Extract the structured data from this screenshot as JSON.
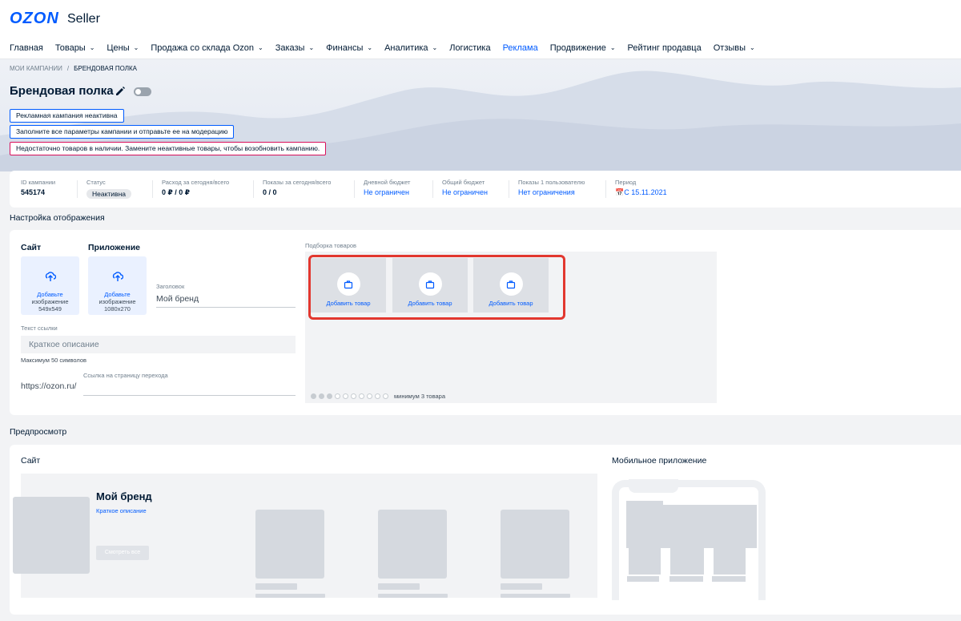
{
  "brand": {
    "logo": "OZON",
    "suffix": "Seller"
  },
  "nav": [
    {
      "label": "Главная",
      "dropdown": false,
      "active": false
    },
    {
      "label": "Товары",
      "dropdown": true,
      "active": false
    },
    {
      "label": "Цены",
      "dropdown": true,
      "active": false
    },
    {
      "label": "Продажа со склада Ozon",
      "dropdown": true,
      "active": false
    },
    {
      "label": "Заказы",
      "dropdown": true,
      "active": false
    },
    {
      "label": "Финансы",
      "dropdown": true,
      "active": false
    },
    {
      "label": "Аналитика",
      "dropdown": true,
      "active": false
    },
    {
      "label": "Логистика",
      "dropdown": false,
      "active": false
    },
    {
      "label": "Реклама",
      "dropdown": false,
      "active": true
    },
    {
      "label": "Продвижение",
      "dropdown": true,
      "active": false
    },
    {
      "label": "Рейтинг продавца",
      "dropdown": false,
      "active": false
    },
    {
      "label": "Отзывы",
      "dropdown": true,
      "active": false
    }
  ],
  "breadcrumb": {
    "parent": "Мои кампании",
    "current": "Брендовая полка"
  },
  "page_title": "Брендовая полка",
  "notices": [
    "Рекламная кампания неактивна",
    "Заполните все параметры кампании и отправьте ее на модерацию",
    "Недостаточно товаров в наличии. Замените неактивные товары, чтобы возобновить кампанию."
  ],
  "stats": {
    "id": {
      "label": "ID кампании",
      "value": "545174"
    },
    "status": {
      "label": "Статус",
      "value": "Неактивна"
    },
    "spend": {
      "label": "Расход за сегодня/всего",
      "value": "0 ₽ / 0 ₽"
    },
    "shows": {
      "label": "Показы за сегодня/всего",
      "value": "0 / 0"
    },
    "daily_budget": {
      "label": "Дневной бюджет",
      "value": "Не ограничен"
    },
    "total_budget": {
      "label": "Общий бюджет",
      "value": "Не ограничен"
    },
    "per_user": {
      "label": "Показы 1 пользователю",
      "value": "Нет ограничения"
    },
    "period": {
      "label": "Период",
      "value": "С 15.11.2021"
    }
  },
  "display_settings": {
    "section_title": "Настройка отображения",
    "site_label": "Сайт",
    "app_label": "Приложение",
    "site_upload": {
      "action": "Добавьте",
      "hint1": "изображение",
      "hint2": "549x549"
    },
    "app_upload": {
      "action": "Добавьте",
      "hint1": "изображение",
      "hint2": "1080x270"
    },
    "heading_label": "Заголовок",
    "heading_value": "Мой бренд",
    "link_text_label": "Текст ссылки",
    "link_text_placeholder": "Краткое описание",
    "max_hint": "Максимум 50 символов",
    "url_prefix": "https://ozon.ru/",
    "url_label": "Ссылка на страницу перехода",
    "picker_label": "Подборка товаров",
    "add_product": "Добавить товар",
    "min_hint": "минимум 3 товара"
  },
  "preview": {
    "section_title": "Предпросмотр",
    "site_label": "Сайт",
    "mobile_label": "Мобильное приложение",
    "brand_name": "Мой бренд",
    "brand_desc": "Краткое описание",
    "view_all": "Смотреть все"
  }
}
